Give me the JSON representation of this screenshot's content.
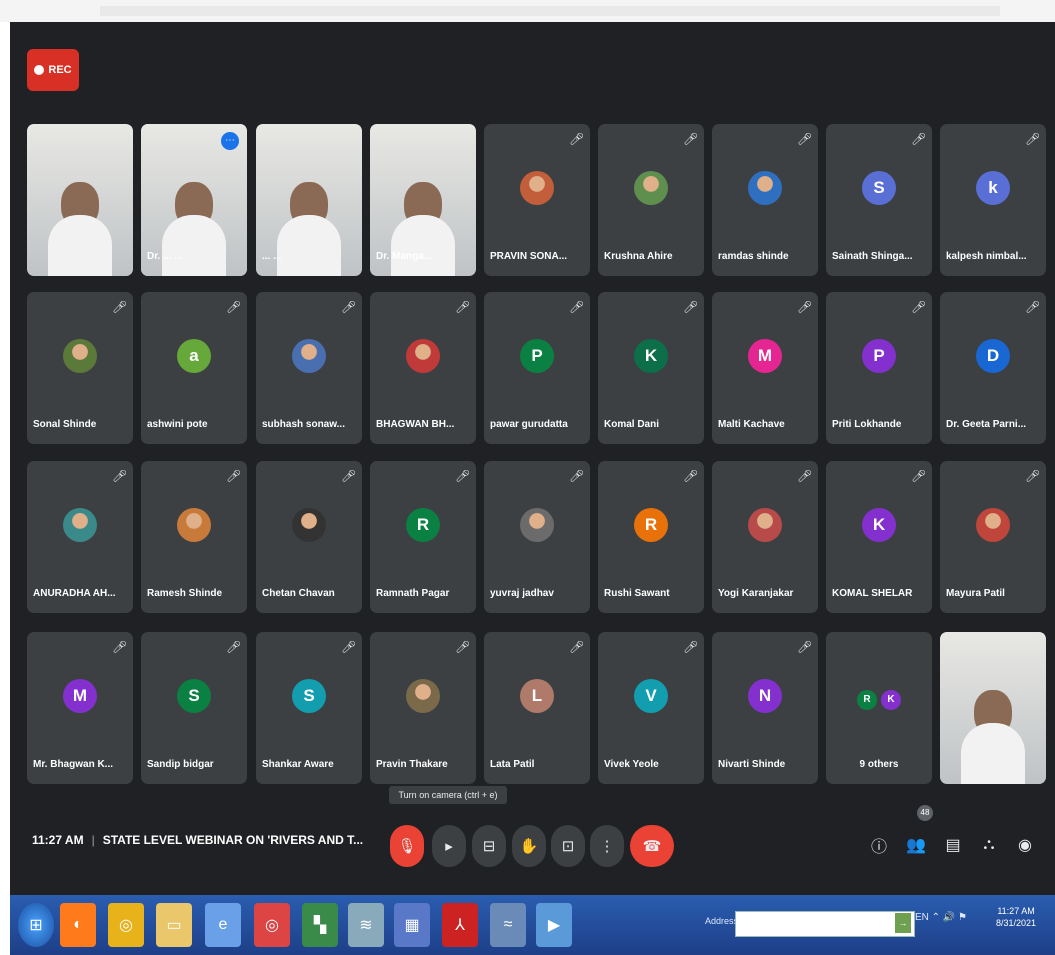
{
  "recording": {
    "label": "REC"
  },
  "tooltip": "Turn on camera (ctrl + e)",
  "meeting": {
    "time": "11:27 AM",
    "title": "STATE LEVEL WEBINAR ON 'RIVERS AND T..."
  },
  "participant_count": "48",
  "overflow": {
    "label": "9 others",
    "initials": [
      "R",
      "K"
    ],
    "colors": [
      "#0b8043",
      "#8430ce"
    ]
  },
  "participants": [
    {
      "name": "",
      "type": "video",
      "initial": "",
      "color": ""
    },
    {
      "name": "Dr. ... ...",
      "type": "video",
      "initial": "",
      "color": "",
      "selected": true
    },
    {
      "name": "... ...",
      "type": "video",
      "initial": "",
      "color": ""
    },
    {
      "name": "Dr. Manga...",
      "type": "video",
      "initial": "",
      "color": ""
    },
    {
      "name": "PRAVIN SONA...",
      "type": "photo",
      "initial": "",
      "color": "#c25e3a"
    },
    {
      "name": "Krushna Ahire",
      "type": "photo",
      "initial": "",
      "color": "#5f8f4f"
    },
    {
      "name": "ramdas shinde",
      "type": "photo",
      "initial": "",
      "color": "#2f6fbf"
    },
    {
      "name": "Sainath Shinga...",
      "type": "initial",
      "initial": "S",
      "color": "#5a6fd6"
    },
    {
      "name": "kalpesh nimbal...",
      "type": "initial",
      "initial": "k",
      "color": "#5a6fd6"
    },
    {
      "name": "Sonal Shinde",
      "type": "photo",
      "initial": "",
      "color": "#5b7a3a"
    },
    {
      "name": "ashwini pote",
      "type": "initial",
      "initial": "a",
      "color": "#67a83a"
    },
    {
      "name": "subhash sonaw...",
      "type": "photo",
      "initial": "",
      "color": "#4a6fb0"
    },
    {
      "name": "BHAGWAN BH...",
      "type": "photo",
      "initial": "",
      "color": "#c03a3a"
    },
    {
      "name": "pawar gurudatta",
      "type": "initial",
      "initial": "P",
      "color": "#0b8043"
    },
    {
      "name": "Komal Dani",
      "type": "initial",
      "initial": "K",
      "color": "#0d6e4a"
    },
    {
      "name": "Malti Kachave",
      "type": "initial",
      "initial": "M",
      "color": "#e52592"
    },
    {
      "name": "Priti Lokhande",
      "type": "initial",
      "initial": "P",
      "color": "#8430ce"
    },
    {
      "name": "Dr. Geeta Parni...",
      "type": "initial",
      "initial": "D",
      "color": "#1967d2"
    },
    {
      "name": "ANURADHA AH...",
      "type": "photo",
      "initial": "",
      "color": "#3a8a8a"
    },
    {
      "name": "Ramesh Shinde",
      "type": "photo",
      "initial": "",
      "color": "#c87a3a"
    },
    {
      "name": "Chetan Chavan",
      "type": "photo",
      "initial": "",
      "color": "#333333"
    },
    {
      "name": "Ramnath Pagar",
      "type": "initial",
      "initial": "R",
      "color": "#0b8043"
    },
    {
      "name": "yuvraj jadhav",
      "type": "photo",
      "initial": "",
      "color": "#6b6b6b"
    },
    {
      "name": "Rushi Sawant",
      "type": "initial",
      "initial": "R",
      "color": "#e8710a"
    },
    {
      "name": "Yogi Karanjakar",
      "type": "photo",
      "initial": "",
      "color": "#b84a4a"
    },
    {
      "name": "KOMAL SHELAR",
      "type": "initial",
      "initial": "K",
      "color": "#8430ce"
    },
    {
      "name": "Mayura Patil",
      "type": "photo",
      "initial": "",
      "color": "#c0453a"
    },
    {
      "name": "Mr. Bhagwan K...",
      "type": "initial",
      "initial": "M",
      "color": "#8430ce"
    },
    {
      "name": "Sandip bidgar",
      "type": "initial",
      "initial": "S",
      "color": "#0b8043"
    },
    {
      "name": "Shankar Aware",
      "type": "initial",
      "initial": "S",
      "color": "#129eaf"
    },
    {
      "name": "Pravin Thakare",
      "type": "photo",
      "initial": "",
      "color": "#7a6a4a"
    },
    {
      "name": "Lata Patil",
      "type": "initial",
      "initial": "L",
      "color": "#b07a6a"
    },
    {
      "name": "Vivek Yeole",
      "type": "initial",
      "initial": "V",
      "color": "#129eaf"
    },
    {
      "name": "Nivarti Shinde",
      "type": "initial",
      "initial": "N",
      "color": "#8430ce"
    }
  ],
  "taskbar": {
    "address_label": "Address",
    "time": "11:27 AM",
    "date": "8/31/2021"
  }
}
